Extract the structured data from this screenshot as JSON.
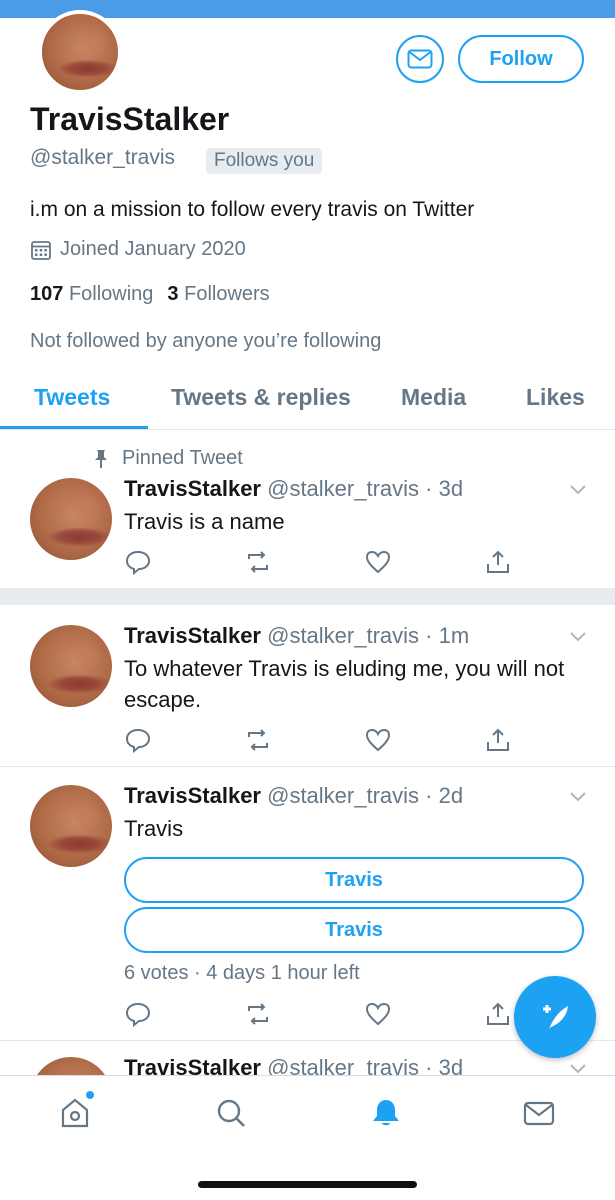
{
  "profile": {
    "display_name": "TravisStalker",
    "handle": "@stalker_travis",
    "follows_you": "Follows you",
    "bio": "i.m on a mission to follow every travis on Twitter",
    "joined": "Joined January 2020",
    "following_count": "107",
    "following_label": "Following",
    "followers_count": "3",
    "followers_label": "Followers",
    "not_followed_note": "Not followed by anyone you’re following",
    "follow_button": "Follow"
  },
  "tabs": [
    {
      "label": "Tweets",
      "active": true
    },
    {
      "label": "Tweets & replies",
      "active": false
    },
    {
      "label": "Media",
      "active": false
    },
    {
      "label": "Likes",
      "active": false
    }
  ],
  "pinned_label": "Pinned Tweet",
  "tweets": [
    {
      "name": "TravisStalker",
      "meta": "@stalker_travis · 3d",
      "text": "Travis is a name"
    },
    {
      "name": "TravisStalker",
      "meta": "@stalker_travis · 1m",
      "text": "To whatever Travis is eluding me, you will not escape."
    },
    {
      "name": "TravisStalker",
      "meta": "@stalker_travis · 2d",
      "text": "Travis",
      "poll": {
        "options": [
          "Travis",
          "Travis"
        ],
        "meta": "6 votes · 4 days 1 hour left"
      }
    },
    {
      "name": "TravisStalker",
      "meta": "@stalker_travis · 3d",
      "text": ""
    }
  ],
  "colors": {
    "accent": "#1da1f2",
    "banner": "#4a9be8",
    "muted": "#657786"
  },
  "icons": {
    "message": "envelope-icon",
    "calendar": "calendar-icon",
    "pin": "pin-icon",
    "reply": "reply-icon",
    "retweet": "retweet-icon",
    "like": "heart-icon",
    "share": "share-icon",
    "compose": "compose-feather-icon",
    "nav": [
      "home-icon",
      "search-icon",
      "notifications-bell-icon",
      "messages-icon"
    ]
  }
}
